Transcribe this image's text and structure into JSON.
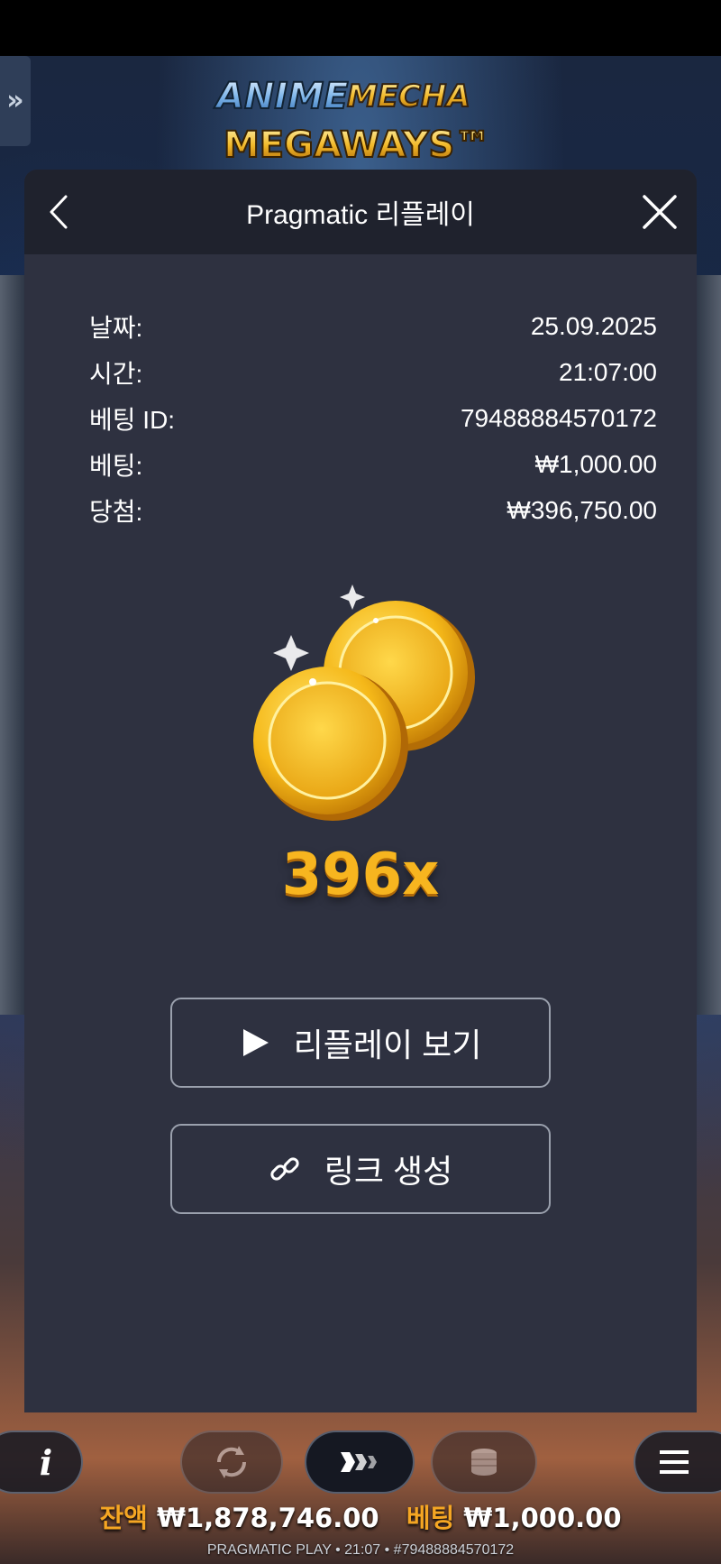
{
  "game": {
    "logo_line1_a": "ANIME",
    "logo_line1_b": "MECHA",
    "logo_line2": "MEGAWAYS™"
  },
  "modal": {
    "title": "Pragmatic 리플레이",
    "rows": [
      {
        "label": "날짜:",
        "value": "25.09.2025"
      },
      {
        "label": "시간:",
        "value": "21:07:00"
      },
      {
        "label": "베팅 ID:",
        "value": "79488884570172"
      },
      {
        "label": "베팅:",
        "value": "₩1,000.00"
      },
      {
        "label": "당첨:",
        "value": "₩396,750.00"
      }
    ],
    "multiplier": "396x",
    "replay_button": "리플레이 보기",
    "link_button": "링크 생성"
  },
  "bottom": {
    "info_icon": "i",
    "balance_label": "잔액",
    "balance_value": "₩1,878,746.00",
    "bet_label": "베팅",
    "bet_value": "₩1,000.00",
    "footer": "PRAGMATIC PLAY • 21:07 • #79488884570172"
  },
  "icons": {
    "side_tab": "chevrons-right-icon",
    "back": "chevron-left-icon",
    "close": "close-icon",
    "play": "play-icon",
    "link": "link-icon",
    "autoplay": "autoplay-icon",
    "turbo": "turbo-icon",
    "coins": "coin-stack-icon",
    "menu": "hamburger-menu-icon"
  },
  "colors": {
    "modal_bg": "#2e3140",
    "header_bg": "#1f222d",
    "multiplier": "#f7b51f",
    "balance_label": "#f5a623"
  }
}
